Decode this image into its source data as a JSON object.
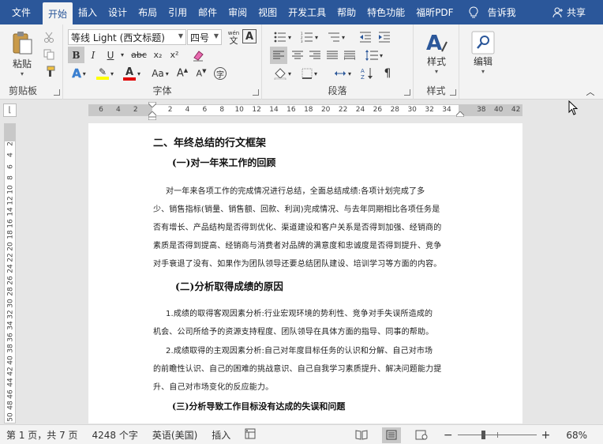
{
  "ribbon_tabs": [
    "文件",
    "开始",
    "插入",
    "设计",
    "布局",
    "引用",
    "邮件",
    "审阅",
    "视图",
    "开发工具",
    "帮助",
    "特色功能",
    "福昕PDF"
  ],
  "active_tab_index": 1,
  "tell_me": "告诉我",
  "share": "共享",
  "clipboard": {
    "label": "剪贴板",
    "paste": "粘贴"
  },
  "font": {
    "label": "字体",
    "name": "等线 Light (西文标题)",
    "size": "四号",
    "wen": "wén"
  },
  "paragraph": {
    "label": "段落"
  },
  "styles": {
    "label": "样式",
    "button": "样式"
  },
  "editing": {
    "label": "编辑",
    "button": "编辑"
  },
  "colors": {
    "ribbon_tab": "#2b579a",
    "highlight": "#ffff00",
    "font_color": "#e00000"
  },
  "ruler_numbers": [
    "6",
    "4",
    "2",
    "",
    "2",
    "4",
    "6",
    "8",
    "10",
    "12",
    "14",
    "16",
    "18",
    "20",
    "22",
    "24",
    "26",
    "28",
    "30",
    "32",
    "34",
    "",
    "38",
    "40",
    "42"
  ],
  "vruler_numbers": [
    "2",
    "4",
    "6",
    "8",
    "10",
    "12",
    "14",
    "16",
    "18",
    "20",
    "22",
    "24",
    "26",
    "28",
    "30",
    "32",
    "34",
    "36",
    "38",
    "40",
    "42",
    "44",
    "46",
    "48",
    "50",
    "52"
  ],
  "doc": {
    "heading2": "二、年终总结的行文框架",
    "sub1": "(一)对一年来工作的回顾",
    "para1": [
      "对一年来各项工作的完成情况进行总结，全面总结成绩:各项计划完成了多",
      "少、销售指标(销量、销售额、回款、利润)完成情况、与去年同期相比各项任务是",
      "否有增长、产品结构是否得到优化、渠道建设和客户关系是否得到加强、经销商的",
      "素质是否得到提高、经销商与消费者对品牌的满意度和忠诚度是否得到提升、竞争",
      "对手衰退了没有、如果作为团队领导还要总结团队建设、培训学习等方面的内容。"
    ],
    "sub2": "(二)分析取得成绩的原因",
    "para2": [
      "1.成绩的取得客观因素分析:行业宏观环境的势利性、竞争对手失误所造成的",
      "机会、公司所给予的资源支持程度、团队领导在具体方面的指导、同事的帮助。",
      "2.成绩取得的主观因素分析:自己对年度目标任务的认识和分解、自己对市场",
      "的前瞻性认识、自己的困难的挑战意识、自己自我学习素质提升、解决问题能力提",
      "升、自己对市场变化的反应能力。"
    ],
    "sub3": "(三)分析导致工作目标没有达成的失误和问题"
  },
  "status": {
    "page": "第 1 页，共 7 页",
    "words": "4248 个字",
    "language": "英语(美国)",
    "insert": "插入",
    "zoom": "68%",
    "zoom_level": 0.68
  }
}
